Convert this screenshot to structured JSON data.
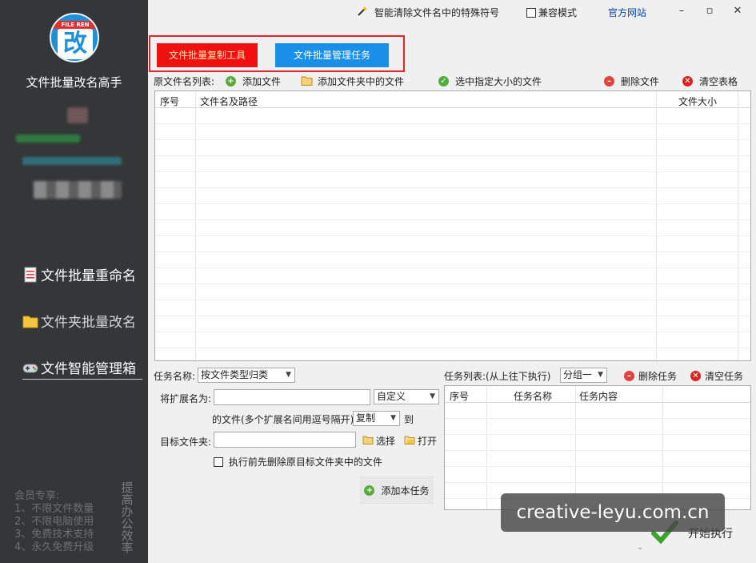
{
  "sidebar": {
    "logo_ribbon": "FILE REN",
    "logo_char": "改",
    "app_title": "文件批量改名高手",
    "nav": [
      {
        "label": "文件批量重命名",
        "icon": "document-icon"
      },
      {
        "label": "文件夹批量改名",
        "icon": "folder-icon"
      },
      {
        "label": "文件智能管理箱",
        "icon": "gamepad-icon"
      }
    ],
    "vip_title": "会员专享:",
    "vip_lines": [
      "1、不限文件数量",
      "2、不限电脑使用",
      "3、免费技术支持",
      "4、永久免费升级"
    ],
    "slogan": "提高办公效率"
  },
  "topbar": {
    "clear_special": "智能清除文件名中的特殊符号",
    "compat_mode": "兼容模式",
    "official_site": "官方网站"
  },
  "tabs": [
    {
      "label": "文件批量复制工具",
      "color": "#f01010"
    },
    {
      "label": "文件批量管理任务",
      "color": "#1a8fe8"
    }
  ],
  "toolbar": {
    "list_label": "原文件名列表:",
    "add_file": "添加文件",
    "add_folder_files": "添加文件夹中的文件",
    "select_by_size": "选中指定大小的文件",
    "delete_file": "删除文件",
    "clear_table": "清空表格"
  },
  "file_table": {
    "columns": [
      "序号",
      "文件名及路径",
      "文件大小"
    ]
  },
  "task_form": {
    "task_name_label": "任务名称:",
    "task_name_value": "按文件类型归类",
    "ext_label": "将扩展名为:",
    "ext_value": "",
    "ext_type": "自定义",
    "middle_text": "的文件(多个扩展名间用逗号隔开)",
    "action_value": "复制",
    "to_text": "到",
    "target_label": "目标文件夹:",
    "target_value": "",
    "choose": "选择",
    "open": "打开",
    "delete_before": "执行前先删除原目标文件夹中的文件",
    "add_task": "添加本任务"
  },
  "task_list": {
    "label": "任务列表:",
    "order_text": "(从上往下执行)",
    "group_value": "分组一",
    "delete_task": "删除任务",
    "clear_task": "清空任务",
    "columns": [
      "序号",
      "任务名称",
      "任务内容"
    ]
  },
  "run_label": "开始执行",
  "watermark": "creative-leyu.com.cn"
}
